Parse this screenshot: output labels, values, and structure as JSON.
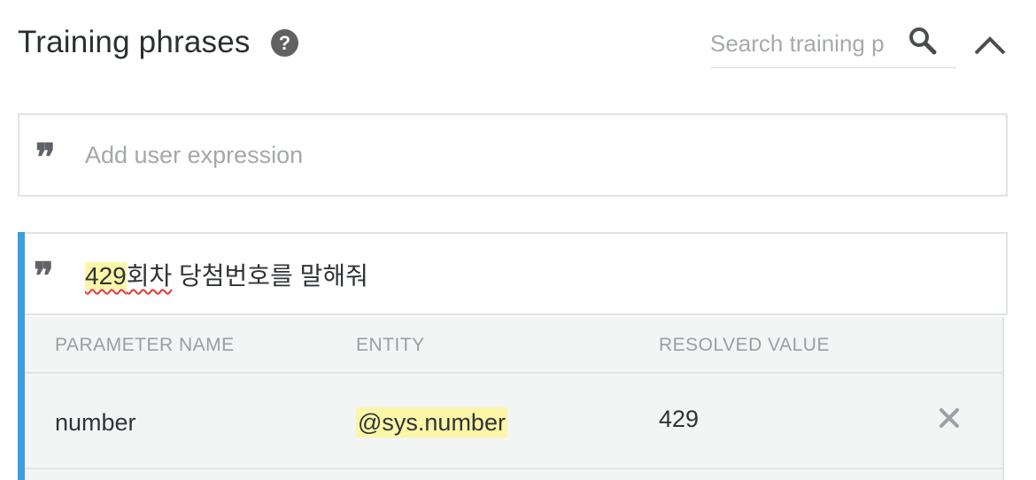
{
  "header": {
    "title": "Training phrases",
    "help_icon": "help-circle-icon",
    "search_placeholder": "Search training p",
    "search_icon": "search-icon",
    "collapse_icon": "chevron-up-icon"
  },
  "add_expression": {
    "icon": "quote-icon",
    "placeholder": "Add user expression"
  },
  "phrases": [
    {
      "icon": "quote-icon",
      "highlighted_part": "429",
      "squiggle_part": "회차",
      "rest": " 당첨번호를 말해줘"
    }
  ],
  "parameter_table": {
    "columns": [
      "PARAMETER NAME",
      "ENTITY",
      "RESOLVED VALUE"
    ],
    "rows": [
      {
        "parameter_name": "number",
        "entity": "@sys.number",
        "resolved_value": "429",
        "remove_icon": "close-icon"
      }
    ]
  },
  "colors": {
    "accent": "#3b9ee3",
    "highlight": "#fcf7a8",
    "icon_gray": "#5f6368"
  }
}
